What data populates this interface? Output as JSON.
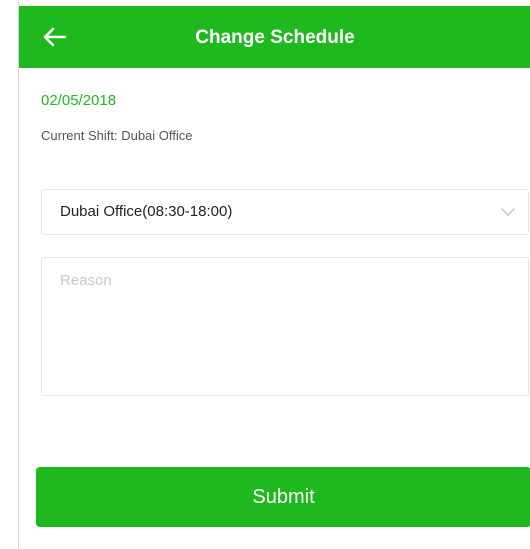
{
  "header": {
    "back_icon": "arrow-left-icon",
    "title": "Change Schedule"
  },
  "info": {
    "date": "02/05/2018",
    "current_shift": "Current Shift: Dubai Office"
  },
  "shift_select": {
    "selected": "Dubai Office(08:30-18:00)",
    "icon": "chevron-down-icon"
  },
  "reason": {
    "placeholder": "Reason",
    "value": ""
  },
  "submit": {
    "label": "Submit"
  },
  "colors": {
    "primary": "#1fb91f",
    "border": "#e6e6e6",
    "placeholder": "#c8c8c8"
  }
}
